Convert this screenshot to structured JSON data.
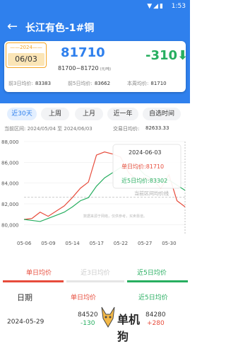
{
  "status": {
    "time": "1:53",
    "icons": "▼◢▮"
  },
  "header": {
    "back_label": "←",
    "title": "长江有色-1#铜"
  },
  "summary": {
    "year": "2024",
    "date": "06/03",
    "price": "81710",
    "range": "81700~81720",
    "unit": "(元/吨)",
    "change": "-310",
    "change_arrow": "⬇",
    "prev3_label": "前3日均价:",
    "prev3_value": "83383",
    "prev5_label": "前5日均价:",
    "prev5_value": "83662",
    "week_label": "本周均价:",
    "week_value": "81710"
  },
  "tabs": [
    {
      "label": "近30天",
      "active": true
    },
    {
      "label": "上周",
      "active": false
    },
    {
      "label": "上月",
      "active": false
    },
    {
      "label": "近一年",
      "active": false
    },
    {
      "label": "自选时间",
      "active": false
    }
  ],
  "info": {
    "interval_label": "当前区间:",
    "interval_value": "2024/05/04 至 2024/06/03",
    "avg_label": "交易日均价:",
    "avg_value": "82633.33"
  },
  "chart_data": {
    "type": "line",
    "x": [
      "05-06",
      "05-07",
      "05-08",
      "05-09",
      "05-10",
      "05-13",
      "05-14",
      "05-15",
      "05-16",
      "05-17",
      "05-20",
      "05-21",
      "05-22",
      "05-23",
      "05-24",
      "05-27",
      "05-28",
      "05-29",
      "05-30",
      "05-31",
      "06-03"
    ],
    "x_ticks": [
      "05-06",
      "05-09",
      "05-14",
      "05-17",
      "05-22",
      "05-27",
      "05-30"
    ],
    "ylim": [
      79000,
      88000
    ],
    "y_ticks": [
      "80,000",
      "82,000",
      "84,000",
      "86,000",
      "88,000"
    ],
    "series": [
      {
        "name": "单日均价",
        "color": "#e74c3c",
        "values": [
          80500,
          80600,
          81200,
          80800,
          81300,
          81800,
          82600,
          83500,
          84100,
          86700,
          87000,
          86800,
          86500,
          85000,
          84300,
          84500,
          84300,
          83500,
          84800,
          82300,
          81710
        ]
      },
      {
        "name": "近5日均价",
        "color": "#27ae60",
        "values": [
          80500,
          80400,
          80300,
          80600,
          80900,
          81200,
          81700,
          82300,
          82600,
          83700,
          84500,
          85000,
          85500,
          85800,
          85600,
          84800,
          84400,
          84200,
          84300,
          83800,
          83302
        ]
      }
    ],
    "reference": {
      "label": "当前区间均价线",
      "value": 82633
    },
    "tooltip": {
      "date": "2024-06-03",
      "line1": "单日均价:81710",
      "line2": "近5日均价:83302"
    },
    "note": "数据来源于网络，仅供参考，买卖靠谱。"
  },
  "legend": [
    {
      "label": "单日均价",
      "color": "#e74c3c"
    },
    {
      "label": "近3日均价",
      "color": "#cccccc"
    },
    {
      "label": "近5日均价",
      "color": "#27ae60"
    }
  ],
  "table": {
    "headers": [
      "日期",
      "单日均价",
      "近5日均价"
    ],
    "rows": [
      {
        "date": "2024-05-29",
        "day_price": "84520",
        "day_change": "-130",
        "avg5_price": "84280",
        "avg5_change": "+280"
      }
    ]
  },
  "watermark": {
    "text": "单机狗"
  }
}
